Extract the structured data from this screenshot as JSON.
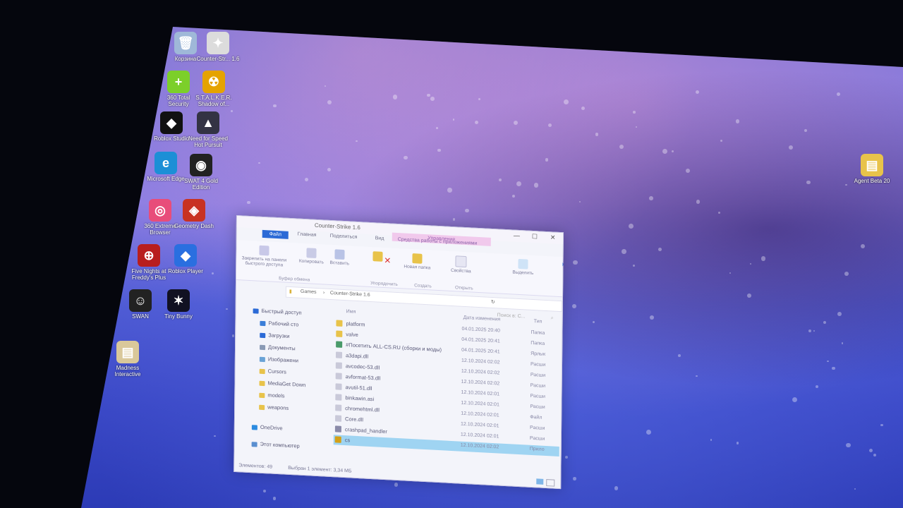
{
  "desktop": {
    "icons": [
      {
        "label": "Корзина",
        "icon": "recycle-bin-icon",
        "color": "#9fb8d8",
        "glyph": "🗑"
      },
      {
        "label": "Counter-Str... 1.6",
        "icon": "counter-strike-icon",
        "color": "#dcdcdc",
        "glyph": "✦"
      },
      {
        "label": "360 Total Security",
        "icon": "shield-icon",
        "color": "#7ccf2a",
        "glyph": "+"
      },
      {
        "label": "S.T.A.L.K.E.R. Shadow of...",
        "icon": "radiation-icon",
        "color": "#e5a300",
        "glyph": "☢"
      },
      {
        "label": "Roblox Studio",
        "icon": "roblox-studio-icon",
        "color": "#111111",
        "glyph": "◆"
      },
      {
        "label": "Need for Speed Hot Pursuit",
        "icon": "game-icon",
        "color": "#333344",
        "glyph": "▲"
      },
      {
        "label": "Microsoft Edge",
        "icon": "edge-icon",
        "color": "#1c8fd6",
        "glyph": "e"
      },
      {
        "label": "SWAT 4 Gold Edition",
        "icon": "swat-icon",
        "color": "#222222",
        "glyph": "◉"
      },
      {
        "label": "360 Extreme Browser",
        "icon": "browser-icon",
        "color": "#e84d7a",
        "glyph": "◎"
      },
      {
        "label": "Geometry Dash",
        "icon": "game-icon",
        "color": "#c83222",
        "glyph": "◈"
      },
      {
        "label": "Five Nights at Freddy's Plus",
        "icon": "target-icon",
        "color": "#b81e1e",
        "glyph": "⊕"
      },
      {
        "label": "Roblox Player",
        "icon": "roblox-icon",
        "color": "#2a6fe0",
        "glyph": "◆"
      },
      {
        "label": "SWAN",
        "icon": "swan-icon",
        "color": "#222222",
        "glyph": "☺"
      },
      {
        "label": "Tiny Bunny",
        "icon": "game-icon",
        "color": "#111122",
        "glyph": "✶"
      },
      {
        "label": "Madness Interactive",
        "icon": "folder-icon",
        "color": "#d9c89a",
        "glyph": "▤"
      },
      {
        "label": "Agent Beta 20",
        "icon": "zip-folder-icon",
        "color": "#e8c34a",
        "glyph": "▤"
      }
    ]
  },
  "window": {
    "title": "Counter-Strike 1.6",
    "context_tab": "Управление",
    "context_sub": "Средства работы с приложениями",
    "tabs": [
      "Файл",
      "Главная",
      "Поделиться",
      "Вид"
    ],
    "ribbon": {
      "pin": "Закрепить на панели быстрого доступа",
      "copy": "Копировать",
      "paste": "Вставить",
      "new_folder": "Новая папка",
      "properties": "Свойства",
      "select": "Выделить",
      "group_clipboard": "Буфер обмена",
      "group_organize": "Упорядочить",
      "group_create": "Создать",
      "group_open": "Открыть"
    },
    "breadcrumb": [
      "Games",
      "Counter-Strike 1.6"
    ],
    "search_placeholder": "Поиск в: C...",
    "nav": [
      {
        "label": "Быстрый доступ",
        "color": "#2b6ad6"
      },
      {
        "label": "Рабочий сто",
        "color": "#3b7ed8"
      },
      {
        "label": "Загрузки",
        "color": "#2b6ad6"
      },
      {
        "label": "Документы",
        "color": "#8a9ab5"
      },
      {
        "label": "Изображени",
        "color": "#6aa3d6"
      },
      {
        "label": "Cursors",
        "color": "#e8c34a"
      },
      {
        "label": "MediaGet Down",
        "color": "#e8c34a"
      },
      {
        "label": "models",
        "color": "#e8c34a"
      },
      {
        "label": "weapons",
        "color": "#e8c34a"
      },
      {
        "label": "OneDrive",
        "color": "#2b8be0"
      },
      {
        "label": "Этот компьютер",
        "color": "#5a8fd0"
      }
    ],
    "columns": {
      "name": "Имя",
      "date": "Дата изменения",
      "type": "Тип"
    },
    "files": [
      {
        "name": "platform",
        "date": "04.01.2025 20:40",
        "type": "Папка",
        "color": "#e8c34a"
      },
      {
        "name": "valve",
        "date": "04.01.2025 20:41",
        "type": "Папка",
        "color": "#e8c34a"
      },
      {
        "name": "#Посетить ALL-CS.RU (сборки и моды)",
        "date": "04.01.2025 20:41",
        "type": "Ярлык",
        "color": "#4a9a6a"
      },
      {
        "name": "a3dapi.dll",
        "date": "12.10.2024 02:02",
        "type": "Расши",
        "color": "#c9c9d9"
      },
      {
        "name": "avcodec-53.dll",
        "date": "12.10.2024 02:02",
        "type": "Расши",
        "color": "#c9c9d9"
      },
      {
        "name": "avformat-53.dll",
        "date": "12.10.2024 02:02",
        "type": "Расши",
        "color": "#c9c9d9"
      },
      {
        "name": "avutil-51.dll",
        "date": "12.10.2024 02:01",
        "type": "Расши",
        "color": "#c9c9d9"
      },
      {
        "name": "binkawin.asi",
        "date": "12.10.2024 02:01",
        "type": "Расши",
        "color": "#c9c9d9"
      },
      {
        "name": "chromehtml.dll",
        "date": "12.10.2024 02:01",
        "type": "Файл",
        "color": "#c9c9d9"
      },
      {
        "name": "Core.dll",
        "date": "12.10.2024 02:01",
        "type": "Расши",
        "color": "#c9c9d9"
      },
      {
        "name": "crashpad_handler",
        "date": "12.10.2024 02:01",
        "type": "Расши",
        "color": "#8a8aa8"
      },
      {
        "name": "cs",
        "date": "12.10.2024 02:02",
        "type": "Прило",
        "color": "#d4a017",
        "selected": true
      }
    ],
    "status_count": "Элементов: 49",
    "status_selected": "Выбран 1 элемент: 3,34 МБ"
  }
}
